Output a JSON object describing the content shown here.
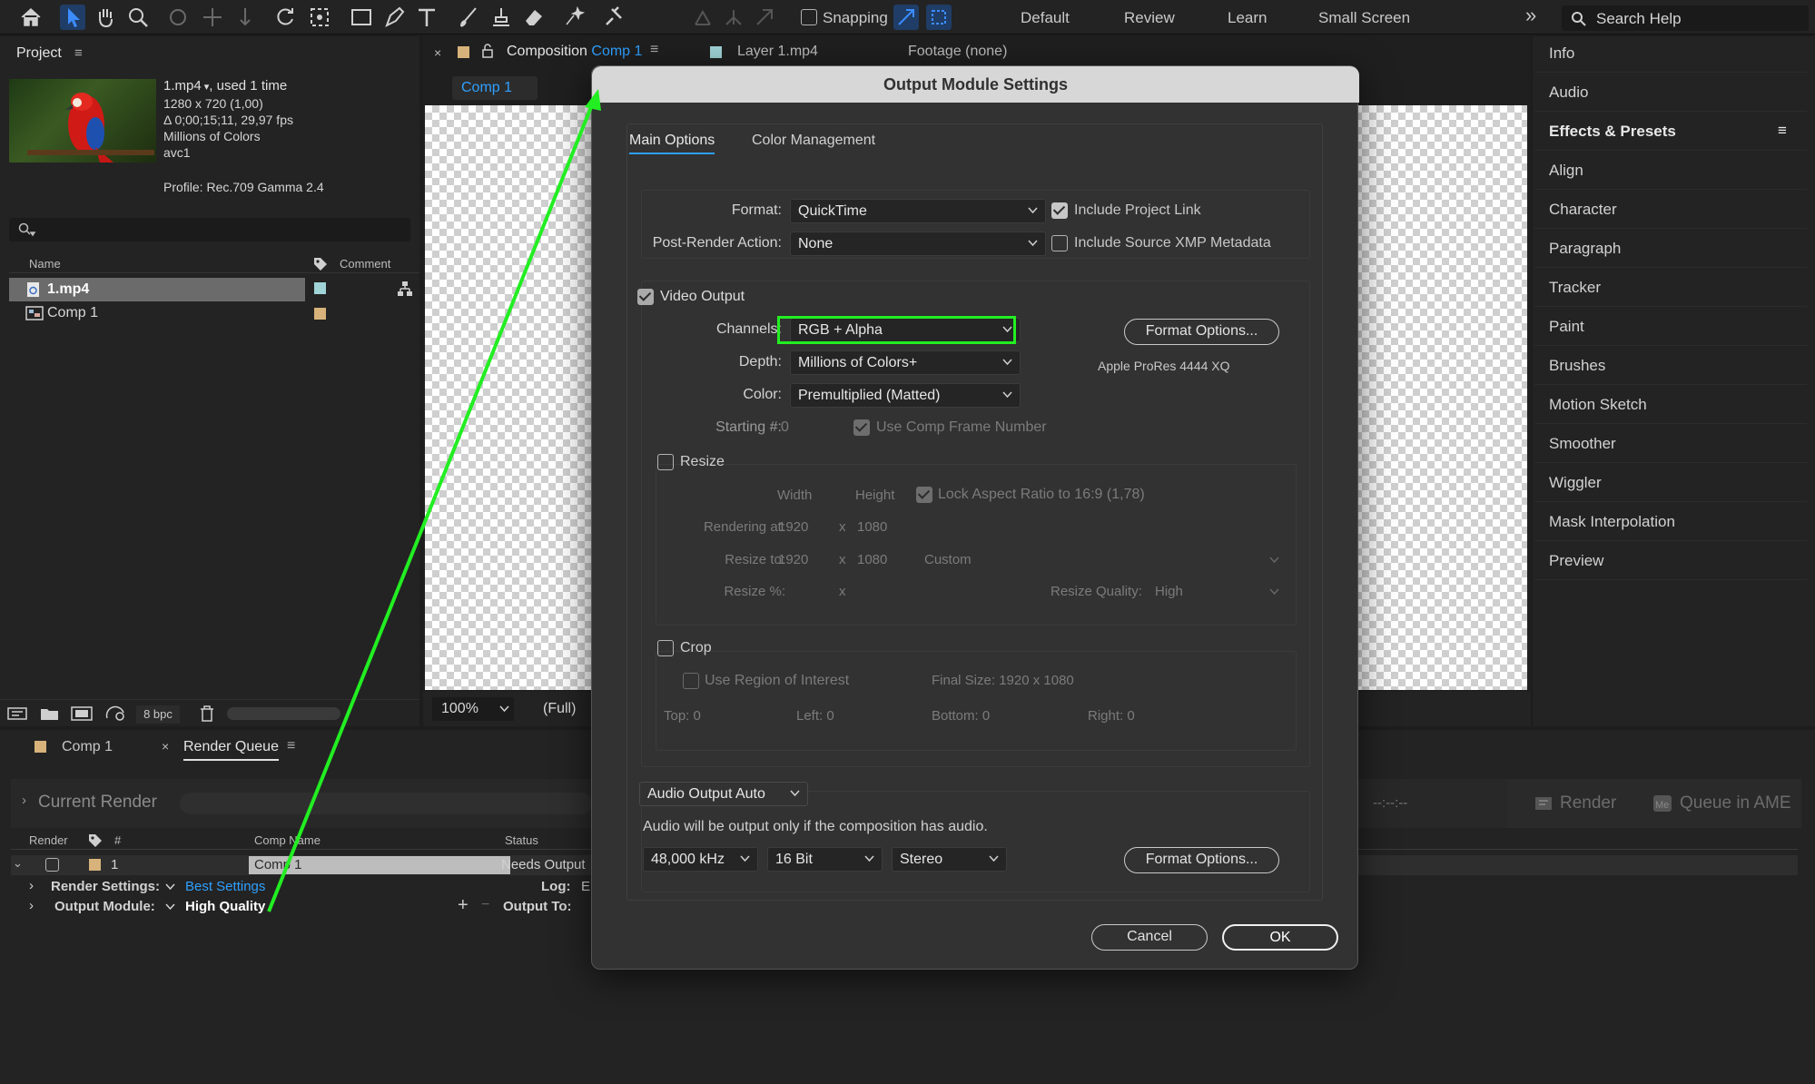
{
  "toolbar": {
    "snapping_label": "Snapping",
    "workspaces": [
      "Default",
      "Review",
      "Learn",
      "Small Screen"
    ],
    "more": "»",
    "search_placeholder": "Search Help"
  },
  "project": {
    "tab": "Project",
    "file_name": "1.mp4",
    "file_used": ", used 1 time",
    "file_info": [
      "1280 x 720 (1,00)",
      "Δ 0;00;15;11, 29,97 fps",
      "Millions of Colors",
      "avc1"
    ],
    "profile": "Profile: Rec.709 Gamma 2.4",
    "col_name": "Name",
    "col_comment": "Comment",
    "items": [
      {
        "name": "1.mp4",
        "color": "#9fd3d6"
      },
      {
        "name": "Comp 1",
        "color": "#d7b27a"
      }
    ],
    "bpc": "8 bpc"
  },
  "viewer": {
    "tab_comp_prefix": "Composition",
    "tab_comp_name": "Comp 1",
    "tab_layer": "Layer 1.mp4",
    "tab_footage": "Footage (none)",
    "sub_tab": "Comp 1",
    "zoom": "100%",
    "resolution": "(Full)"
  },
  "right_panel": {
    "items": [
      "Info",
      "Audio",
      "Effects & Presets",
      "Align",
      "Character",
      "Paragraph",
      "Tracker",
      "Paint",
      "Brushes",
      "Motion Sketch",
      "Smoother",
      "Wiggler",
      "Mask Interpolation",
      "Preview"
    ]
  },
  "dialog": {
    "title": "Output Module Settings",
    "tabs": [
      "Main Options",
      "Color Management"
    ],
    "format_label": "Format:",
    "format_value": "QuickTime",
    "include_project_link": "Include Project Link",
    "post_render_label": "Post-Render Action:",
    "post_render_value": "None",
    "include_xmp": "Include Source XMP Metadata",
    "video_output": "Video Output",
    "channels_label": "Channels:",
    "channels_value": "RGB + Alpha",
    "format_options": "Format Options...",
    "codec": "Apple ProRes 4444 XQ",
    "depth_label": "Depth:",
    "depth_value": "Millions of Colors+",
    "color_label": "Color:",
    "color_value": "Premultiplied (Matted)",
    "starting_label": "Starting #:",
    "starting_value": "0",
    "use_comp_frame": "Use Comp Frame Number",
    "resize": "Resize",
    "width_label": "Width",
    "height_label": "Height",
    "lock_aspect": "Lock Aspect Ratio to 16:9 (1,78)",
    "rendering_at_label": "Rendering at:",
    "rendering_w": "1920",
    "rendering_h": "1080",
    "resize_to_label": "Resize to:",
    "resize_w": "1920",
    "resize_h": "1080",
    "resize_preset": "Custom",
    "resize_pct_label": "Resize %:",
    "x": "x",
    "resize_quality_label": "Resize Quality:",
    "resize_quality": "High",
    "crop": "Crop",
    "use_roi": "Use Region of Interest",
    "final_size": "Final Size: 1920 x 1080",
    "top": "Top:  0",
    "left": "Left:  0",
    "bottom": "Bottom:  0",
    "right": "Right:  0",
    "audio_output": "Audio Output Auto",
    "audio_note": "Audio will be output only if the composition has audio.",
    "sample_rate": "48,000 kHz",
    "bit_depth": "16 Bit",
    "channels_audio": "Stereo",
    "audio_format_options": "Format Options...",
    "cancel": "Cancel",
    "ok": "OK"
  },
  "render_queue": {
    "tab_comp": "Comp 1",
    "tab_rq": "Render Queue",
    "current_render": "Current Render",
    "time": "--:--:--",
    "render_btn": "Render",
    "queue_ame": "Queue in AME",
    "col_render": "Render",
    "col_num": "#",
    "col_comp": "Comp Name",
    "col_status": "Status",
    "item_num": "1",
    "item_comp": "Comp 1",
    "item_status": "Needs Output",
    "render_settings_label": "Render Settings:",
    "render_settings_value": "Best Settings",
    "log_label": "Log:",
    "log_value": "E",
    "output_module_label": "Output Module:",
    "output_module_value": "High Quality",
    "output_to_label": "Output To:"
  },
  "accent": "#2fa0ff",
  "highlight": "#22ee22"
}
